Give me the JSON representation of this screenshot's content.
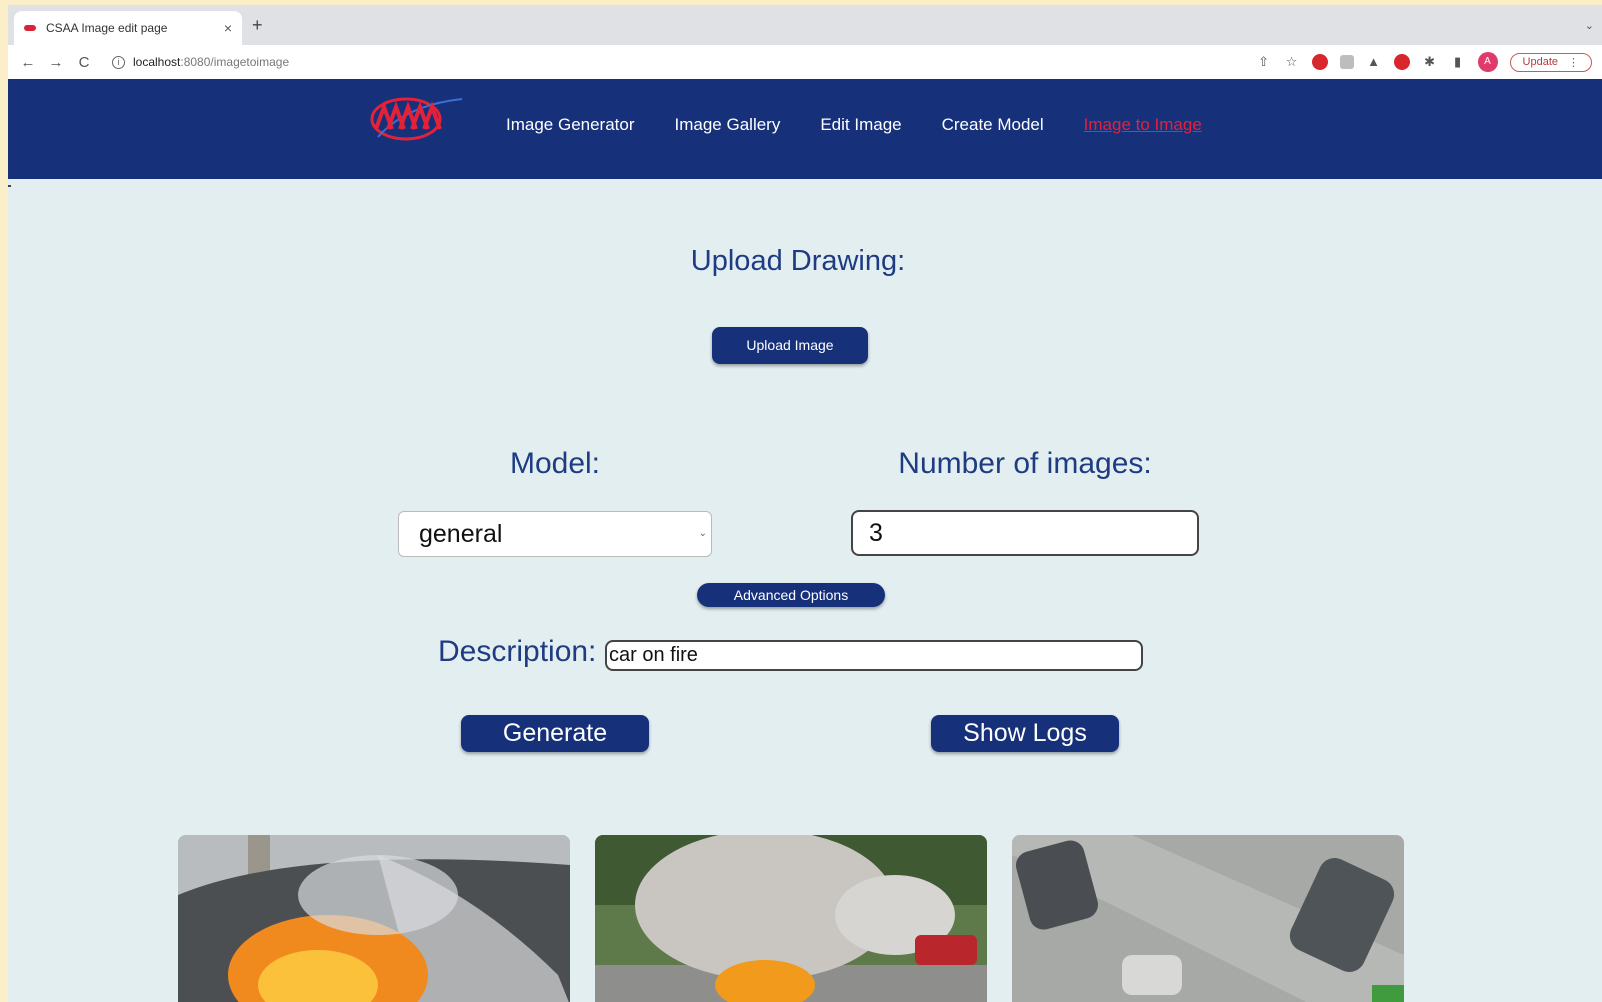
{
  "browser": {
    "tab_title": "CSAA Image edit page",
    "tab_close": "×",
    "new_tab": "+",
    "tab_menu": "⌄",
    "back": "←",
    "forward": "→",
    "reload": "C",
    "url_host": "localhost",
    "url_path": ":8080/imagetoimage",
    "update_label": "Update"
  },
  "header": {
    "nav": [
      {
        "label": "Image Generator",
        "active": false
      },
      {
        "label": "Image Gallery",
        "active": false
      },
      {
        "label": "Edit Image",
        "active": false
      },
      {
        "label": "Create Model",
        "active": false
      },
      {
        "label": "Image to Image",
        "active": true
      }
    ]
  },
  "main": {
    "upload_title": "Upload Drawing:",
    "upload_button": "Upload Image",
    "model_label": "Model:",
    "model_value": "general",
    "num_images_label": "Number of images:",
    "num_images_value": "3",
    "advanced_button": "Advanced Options",
    "description_label": "Description:",
    "description_value": "car on fire",
    "generate_button": "Generate",
    "logs_button": "Show Logs"
  },
  "colors": {
    "header_bg": "#16307a",
    "accent_active": "#e3223a",
    "page_bg": "#e3eef1",
    "heading_text": "#1f3c83"
  }
}
